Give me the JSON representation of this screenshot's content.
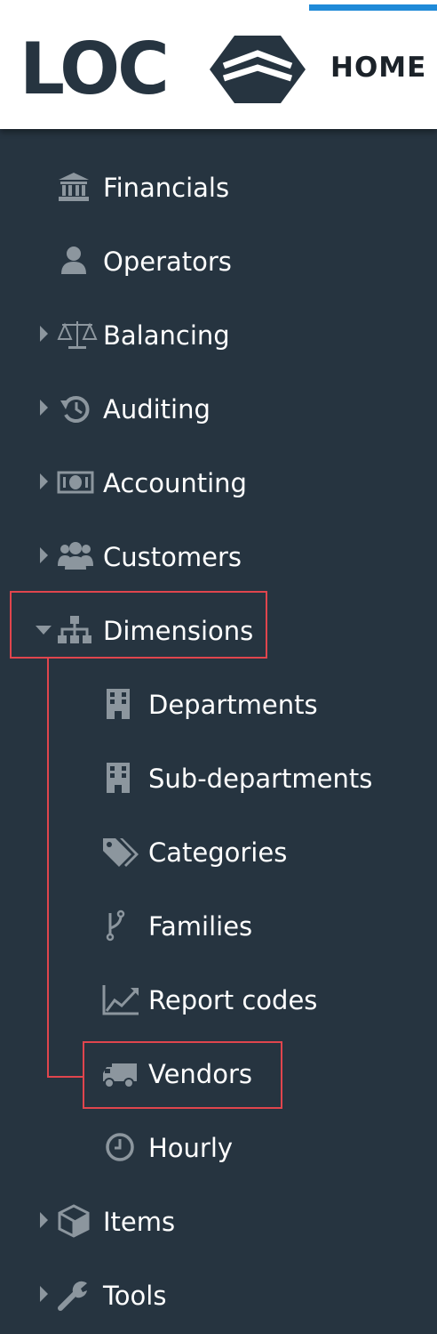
{
  "header": {
    "logo_text": "LOC",
    "home_tab": "HOME"
  },
  "sidebar": {
    "items": [
      {
        "label": "Financials",
        "icon": "bank-icon",
        "expandable": false
      },
      {
        "label": "Operators",
        "icon": "user-icon",
        "expandable": false
      },
      {
        "label": "Balancing",
        "icon": "scale-icon",
        "expandable": true
      },
      {
        "label": "Auditing",
        "icon": "history-icon",
        "expandable": true
      },
      {
        "label": "Accounting",
        "icon": "money-icon",
        "expandable": true
      },
      {
        "label": "Customers",
        "icon": "users-icon",
        "expandable": true
      },
      {
        "label": "Dimensions",
        "icon": "sitemap-icon",
        "expandable": true,
        "expanded": true,
        "children": [
          {
            "label": "Departments",
            "icon": "building-icon"
          },
          {
            "label": "Sub-departments",
            "icon": "building-icon"
          },
          {
            "label": "Categories",
            "icon": "tags-icon"
          },
          {
            "label": "Families",
            "icon": "branch-icon"
          },
          {
            "label": "Report codes",
            "icon": "area-chart-icon"
          },
          {
            "label": "Vendors",
            "icon": "truck-icon"
          },
          {
            "label": "Hourly",
            "icon": "clock-icon"
          }
        ]
      },
      {
        "label": "Items",
        "icon": "cube-icon",
        "expandable": true
      },
      {
        "label": "Tools",
        "icon": "wrench-icon",
        "expandable": true
      }
    ]
  },
  "highlight_color": "#e0454d",
  "accent_color": "#1f8ad8",
  "sidebar_color": "#263440"
}
